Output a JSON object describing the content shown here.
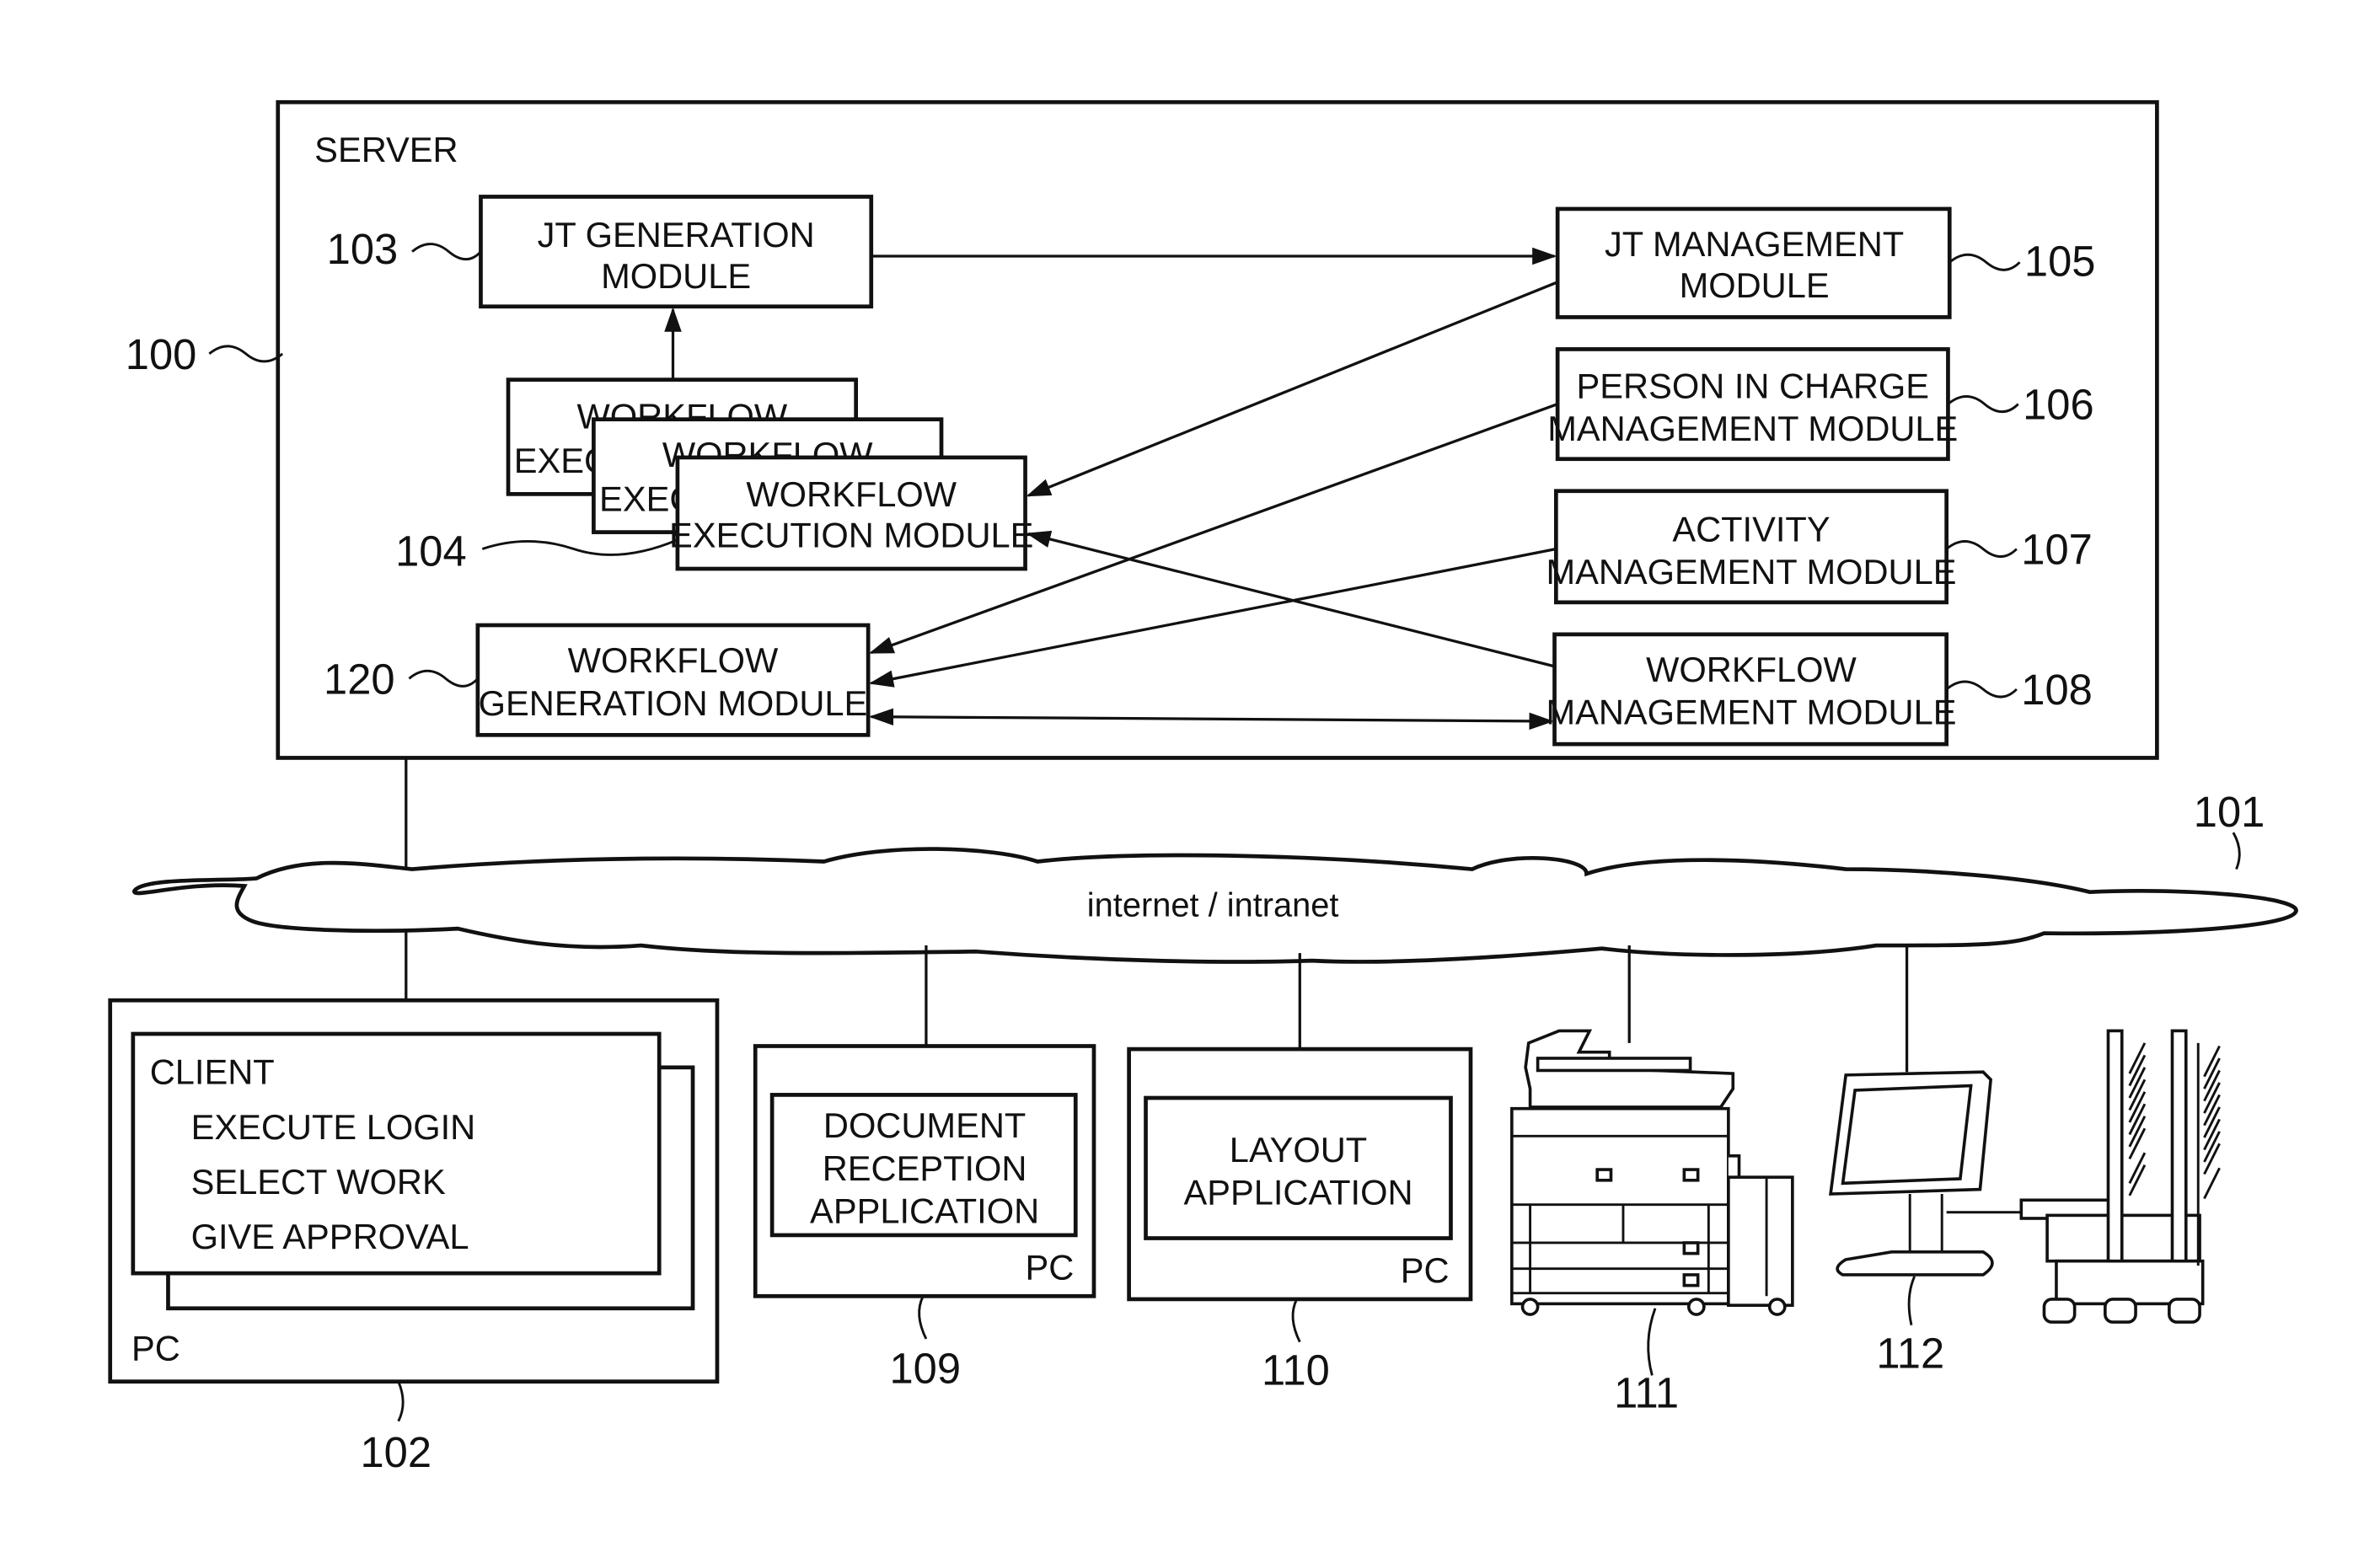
{
  "figure": {
    "server": {
      "label": "SERVER",
      "ref": "100",
      "modules": {
        "jt_generation": {
          "line1": "JT GENERATION",
          "line2": "MODULE",
          "ref": "103"
        },
        "workflow_execution": {
          "line1": "WORKFLOW",
          "line2": "EXECUTION MODULE",
          "ref": "104",
          "stack_partial_top": "WORKFLOW",
          "stack_partial_left": "EXEC"
        },
        "workflow_generation": {
          "line1": "WORKFLOW",
          "line2": "GENERATION MODULE",
          "ref": "120"
        },
        "jt_management": {
          "line1": "JT MANAGEMENT",
          "line2": "MODULE",
          "ref": "105"
        },
        "person_in_charge": {
          "line1": "PERSON IN CHARGE",
          "line2": "MANAGEMENT MODULE",
          "ref": "106"
        },
        "activity_management": {
          "line1": "ACTIVITY",
          "line2": "MANAGEMENT MODULE",
          "ref": "107"
        },
        "workflow_management": {
          "line1": "WORKFLOW",
          "line2": "MANAGEMENT MODULE",
          "ref": "108"
        }
      }
    },
    "network": {
      "label": "internet / intranet",
      "ref": "101"
    },
    "client_pc": {
      "title": "CLIENT",
      "items": [
        "EXECUTE LOGIN",
        "SELECT WORK",
        "GIVE APPROVAL"
      ],
      "pc_label": "PC",
      "ref": "102"
    },
    "document_pc": {
      "line1": "DOCUMENT",
      "line2": "RECEPTION",
      "line3": "APPLICATION",
      "pc_label": "PC",
      "ref": "109"
    },
    "layout_pc": {
      "line1": "LAYOUT",
      "line2": "APPLICATION",
      "pc_label": "PC",
      "ref": "110"
    },
    "printer": {
      "ref": "111"
    },
    "finisher_terminal": {
      "ref": "112"
    }
  }
}
